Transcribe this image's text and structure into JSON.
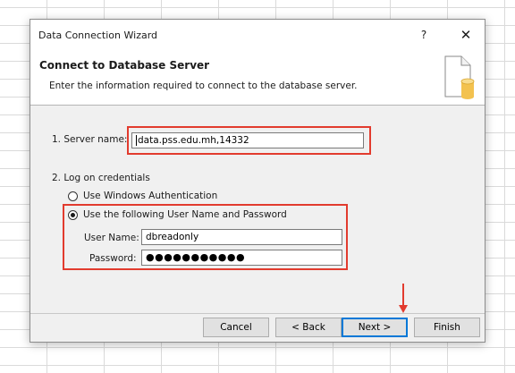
{
  "window": {
    "title": "Data Connection Wizard",
    "help_glyph": "?",
    "close_glyph": "✕"
  },
  "header": {
    "title": "Connect to Database Server",
    "description": "Enter the information required to connect to the database server.",
    "icon": "database-document-icon"
  },
  "server": {
    "label": "1. Server name:",
    "value": "data.pss.edu.mh,14332"
  },
  "credentials": {
    "label": "2. Log on credentials",
    "windows_auth": {
      "label": "Use Windows Authentication",
      "checked": false
    },
    "user_password": {
      "label": "Use the following User Name and Password",
      "checked": true
    },
    "username": {
      "label": "User Name:",
      "value": "dbreadonly"
    },
    "password": {
      "label": "Password:",
      "masked": "●●●●●●●●●●●"
    }
  },
  "buttons": {
    "cancel": "Cancel",
    "back": "< Back",
    "next": "Next >",
    "finish": "Finish"
  },
  "colors": {
    "highlight": "#e23b2e",
    "default_button_border": "#0078d7"
  }
}
